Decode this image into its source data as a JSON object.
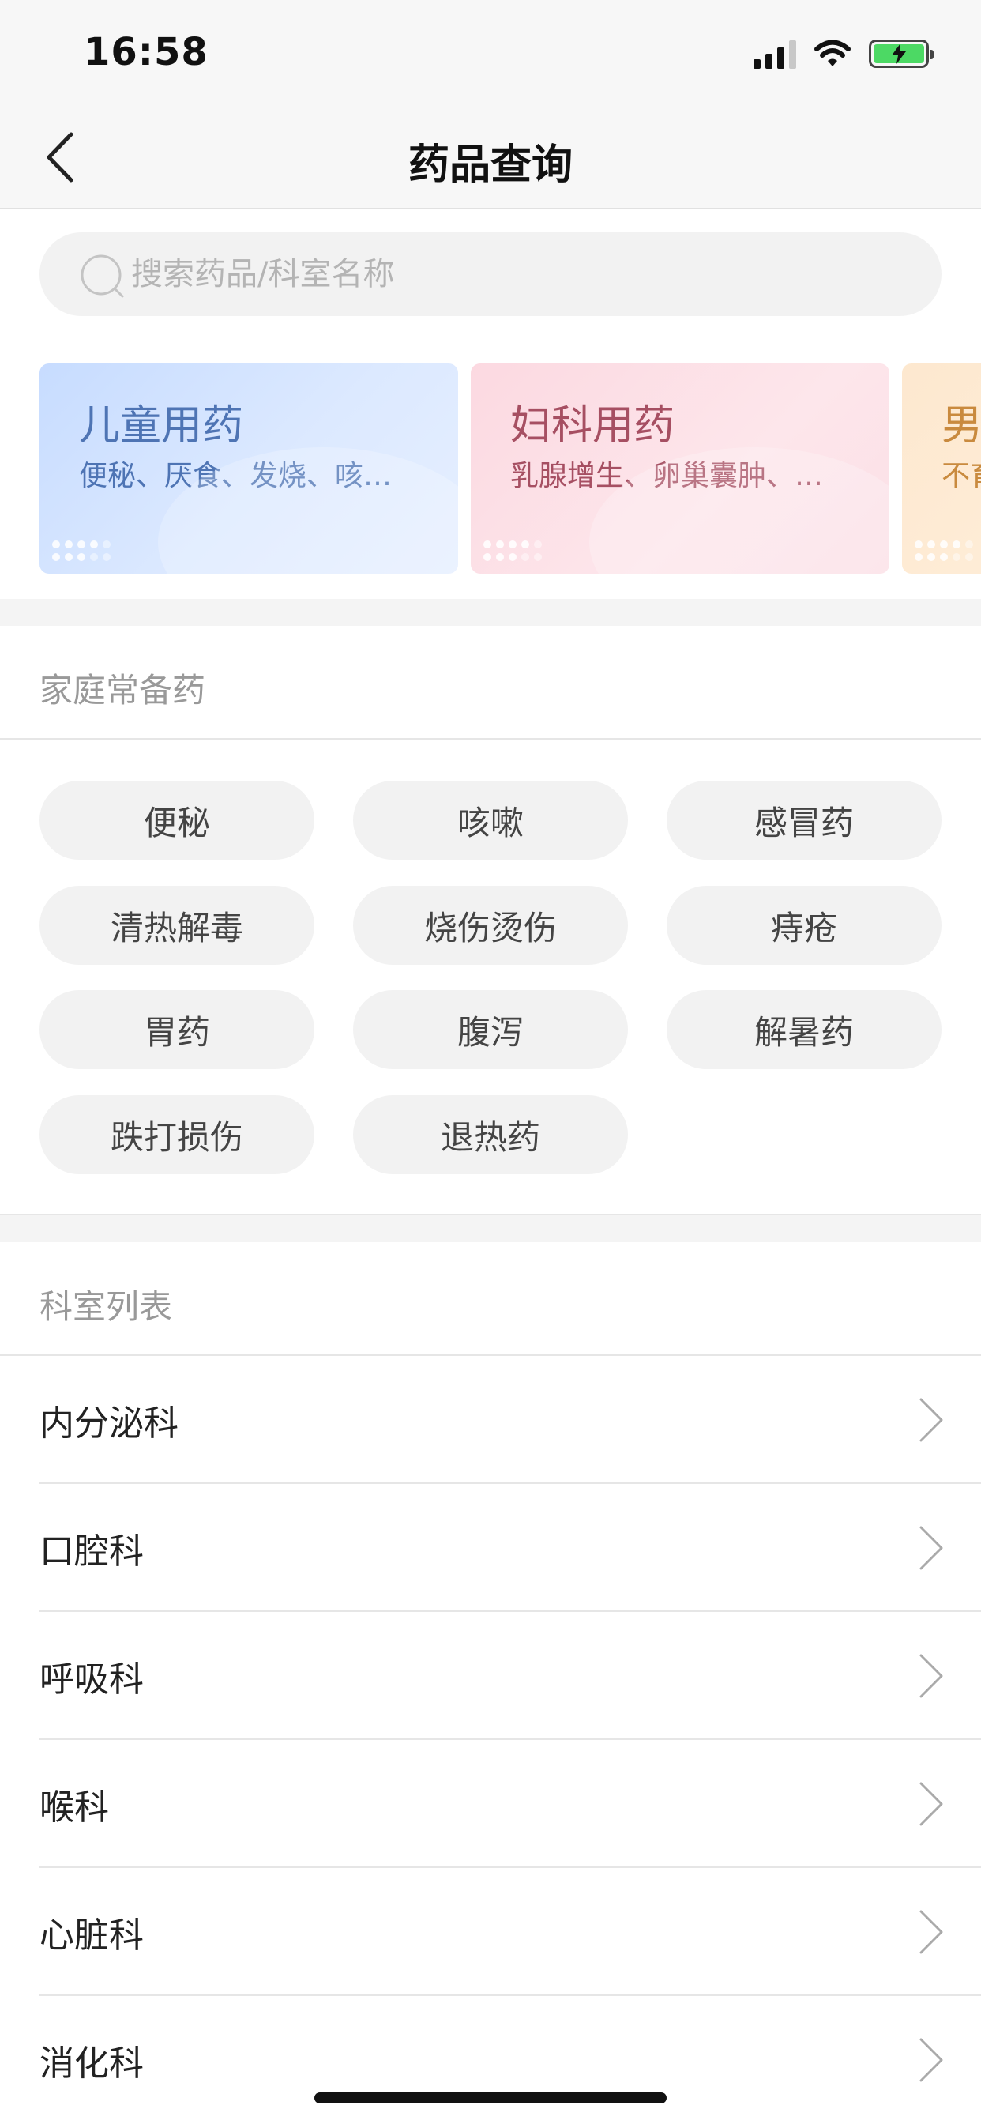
{
  "status": {
    "time": "16:58"
  },
  "nav": {
    "title": "药品查询"
  },
  "search": {
    "placeholder": "搜索药品/科室名称",
    "value": ""
  },
  "cards": [
    {
      "title": "儿童用药",
      "subtitle": "便秘、厌食、发烧、咳…"
    },
    {
      "title": "妇科用药",
      "subtitle": "乳腺增生、卵巢囊肿、…"
    },
    {
      "title": "男",
      "subtitle": "不育"
    }
  ],
  "common": {
    "title": "家庭常备药",
    "tags": [
      "便秘",
      "咳嗽",
      "感冒药",
      "清热解毒",
      "烧伤烫伤",
      "痔疮",
      "胃药",
      "腹泻",
      "解暑药",
      "跌打损伤",
      "退热药"
    ]
  },
  "departments": {
    "title": "科室列表",
    "items": [
      "内分泌科",
      "口腔科",
      "呼吸科",
      "喉科",
      "心脏科",
      "消化科"
    ]
  },
  "colors": {
    "accent_child": "#4e74b4",
    "accent_gyn": "#a64f62",
    "accent_male": "#c98a3e",
    "battery": "#4cd964"
  }
}
